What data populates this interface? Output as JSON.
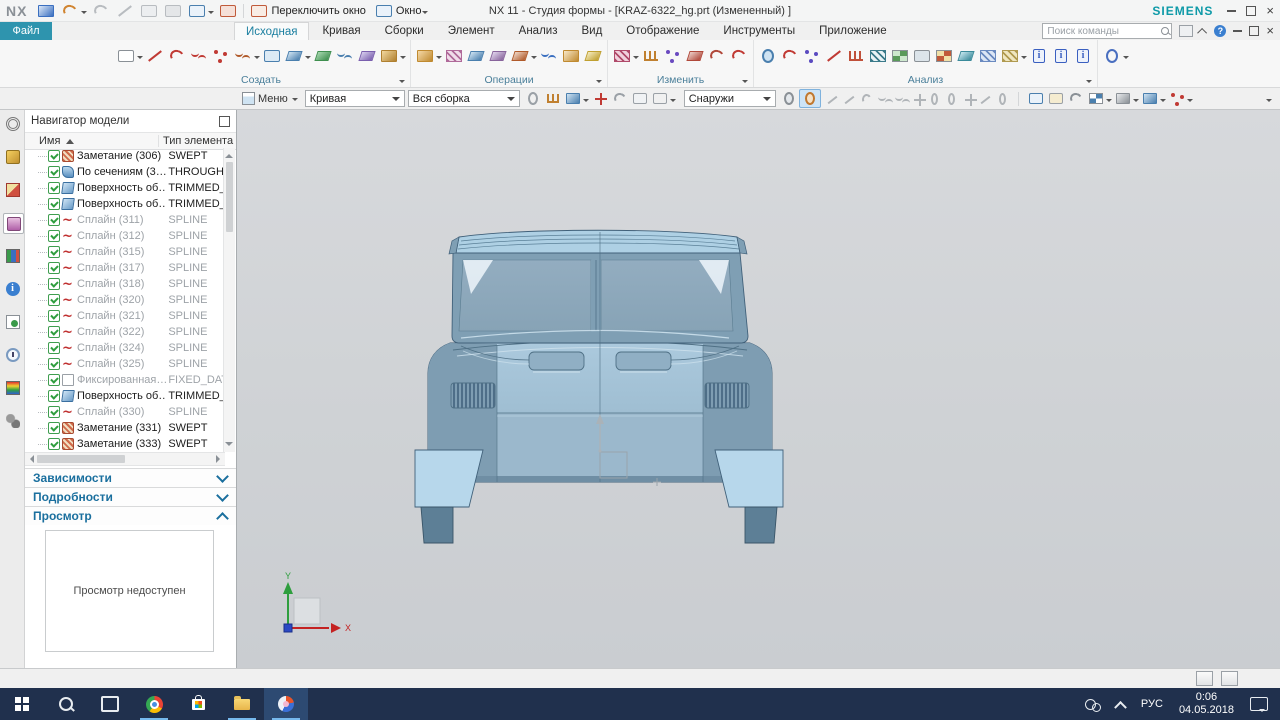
{
  "titlebar": {
    "logo": "NX",
    "title": "NX 11 - Студия формы - [KRAZ-6322_hg.prt (Измененный) ]",
    "brand": "SIEMENS",
    "switch_window": "Переключить окно",
    "window_menu": "Окно",
    "quick_icons": [
      {
        "name": "save",
        "s": "s-cube",
        "c1": "#3a6fc0",
        "c2": "#dce8f8"
      },
      {
        "name": "undo",
        "s": "s-arc",
        "c1": "#d08430",
        "dd": true
      },
      {
        "name": "redo",
        "s": "s-arc",
        "c1": "#b8bcc0"
      },
      {
        "name": "cut",
        "s": "s-line",
        "c1": "#b8bcc0"
      },
      {
        "name": "copy",
        "s": "s-rect",
        "c1": "#b8bcc0",
        "c2": "#eceef0"
      },
      {
        "name": "paste",
        "s": "s-rect",
        "c1": "#b8bcc0",
        "c2": "#e4e6e8"
      },
      {
        "name": "display-window",
        "s": "s-rect",
        "c1": "#4a7fae",
        "c2": "#eaf2fa",
        "dd": true
      },
      {
        "name": "touch-mode",
        "s": "s-rect",
        "c1": "#c05a3a",
        "c2": "#f5e0d8"
      }
    ]
  },
  "tabs": {
    "file": "Файл",
    "search_placeholder": "Поиск команды",
    "items": [
      {
        "label": "Исходная",
        "active": true
      },
      {
        "label": "Кривая"
      },
      {
        "label": "Сборки"
      },
      {
        "label": "Элемент"
      },
      {
        "label": "Анализ"
      },
      {
        "label": "Вид"
      },
      {
        "label": "Отображение"
      },
      {
        "label": "Инструменты"
      },
      {
        "label": "Приложение"
      }
    ]
  },
  "ribbon": {
    "groups": [
      {
        "label": "Создать",
        "icons": [
          {
            "name": "sketch",
            "s": "s-rect",
            "c1": "#8a9096",
            "c2": "#ffffff",
            "dd": true
          },
          {
            "name": "line",
            "s": "s-line",
            "c1": "#c03a34"
          },
          {
            "name": "arc",
            "s": "s-arc",
            "c1": "#c03a34"
          },
          {
            "name": "studio-spline",
            "s": "s-wave",
            "c1": "#c03a34"
          },
          {
            "name": "spline-points",
            "s": "s-dots",
            "c1": "#c03a34"
          },
          {
            "name": "more-curves",
            "s": "s-wave",
            "c1": "#b05a2a",
            "dd": true
          },
          {
            "name": "box",
            "s": "s-rect",
            "c1": "#4a7fae",
            "c2": "#dceaf5"
          },
          {
            "name": "datum-plane",
            "s": "s-sheet",
            "c1": "#4a7fae",
            "c2": "#cfe3f2",
            "dd": true
          },
          {
            "name": "ruled-surface",
            "s": "s-sheet",
            "c1": "#3f8f4f",
            "c2": "#a8d8b0"
          },
          {
            "name": "through-curves",
            "s": "s-wave",
            "c1": "#4a7fae"
          },
          {
            "name": "swept-surface",
            "s": "s-sheet",
            "c1": "#7a5fae",
            "c2": "#d8cfee"
          },
          {
            "name": "shell",
            "s": "s-cube",
            "c1": "#b08030",
            "c2": "#f3d9a0",
            "dd": true
          }
        ]
      },
      {
        "label": "Операции",
        "icons": [
          {
            "name": "join",
            "s": "s-cube",
            "c1": "#c08a30",
            "c2": "#f5d9a8",
            "dd": true
          },
          {
            "name": "offset-surface",
            "s": "s-stripes",
            "c1": "#b06a9a",
            "c2": "#f0dcea"
          },
          {
            "name": "trimmed-sheet",
            "s": "s-sheet",
            "c1": "#4a7fae",
            "c2": "#cfe3f2"
          },
          {
            "name": "trim-body",
            "s": "s-sheet",
            "c1": "#88649c",
            "c2": "#e2d6ee"
          },
          {
            "name": "x-trim",
            "s": "s-sheet",
            "c1": "#b05a2a",
            "c2": "#f0d8c8",
            "dd": true
          },
          {
            "name": "through-curve-mesh",
            "s": "s-wave",
            "c1": "#3a6fc0"
          },
          {
            "name": "bounded-plane",
            "s": "s-cube",
            "c1": "#c08a30",
            "c2": "#f8e8c8"
          },
          {
            "name": "patch",
            "s": "s-sheet",
            "c1": "#c0a030",
            "c2": "#f5ecc0"
          }
        ]
      },
      {
        "label": "Изменить",
        "icons": [
          {
            "name": "x-form",
            "s": "s-stripes",
            "c1": "#b04a6a",
            "c2": "#f0d0dc",
            "dd": true
          },
          {
            "name": "deform-surface",
            "s": "s-comb",
            "c1": "#c08030"
          },
          {
            "name": "edit-pole",
            "s": "s-dots",
            "c1": "#6a4ac0"
          },
          {
            "name": "smooth-surface",
            "s": "s-sheet",
            "c1": "#b0483a",
            "c2": "#eccfc8"
          },
          {
            "name": "match-edge",
            "s": "s-arc",
            "c1": "#b0483a"
          },
          {
            "name": "refit-curve",
            "s": "s-arc",
            "c1": "#c03a34"
          }
        ]
      },
      {
        "label": "Анализ",
        "icons": [
          {
            "name": "section-analysis",
            "s": "s-circle",
            "c1": "#4a7fae",
            "c2": "#cfe3f2"
          },
          {
            "name": "curvature-comb",
            "s": "s-arc",
            "c1": "#c03a34"
          },
          {
            "name": "deviation-gauge",
            "s": "s-dots",
            "c1": "#5a4ac0"
          },
          {
            "name": "measure-line",
            "s": "s-line",
            "c1": "#c03a34"
          },
          {
            "name": "hedgehog",
            "s": "s-comb",
            "c1": "#c0503a"
          },
          {
            "name": "zebra-stripes",
            "s": "s-stripes",
            "c1": "#3a7a8a",
            "c2": "#e8f2f5"
          },
          {
            "name": "reflection-map",
            "s": "s-grid",
            "c1": "#5a9a5a",
            "c2": "#cde8cd"
          },
          {
            "name": "draft-analysis",
            "s": "s-rect",
            "c1": "#8a9096",
            "c2": "#dce4ea"
          },
          {
            "name": "face-curvature",
            "s": "s-grid",
            "c1": "#c05a3a",
            "c2": "#f0e0a8"
          },
          {
            "name": "reflection-plane",
            "s": "s-sheet",
            "c1": "#3a8a9a",
            "c2": "#c8e8f0"
          },
          {
            "name": "grid-analysis",
            "s": "s-stripes",
            "c1": "#6a8ac0",
            "c2": "#dce6f5"
          },
          {
            "name": "gauge-ruler",
            "s": "s-stripes",
            "c1": "#b09a50",
            "c2": "#efe6c0",
            "dd": true
          },
          {
            "name": "info-object",
            "s": "s-tag",
            "c1": "#3a5fc0"
          },
          {
            "name": "info-spline",
            "s": "s-tag",
            "c1": "#3a5fc0"
          },
          {
            "name": "info-sheet",
            "s": "s-tag",
            "c1": "#3a5fc0"
          }
        ]
      },
      {
        "label": "",
        "icons": [
          {
            "name": "hd3d-tool",
            "s": "s-circle",
            "c1": "#4a6fc0",
            "dd": true
          }
        ]
      }
    ]
  },
  "border_bar": {
    "menu": "Меню",
    "type_combo": "Кривая",
    "scope_combo": "Вся сборка",
    "filter_combo": "Снаружи",
    "left_icons": [
      {
        "name": "touch-filter",
        "s": "s-circle",
        "c1": "#9aa0a6"
      },
      {
        "name": "selection-hand",
        "s": "s-comb",
        "c1": "#c08030"
      },
      {
        "name": "filter-cube",
        "s": "s-cube",
        "c1": "#4a7fae",
        "c2": "#cfe3f2",
        "dd": true
      },
      {
        "name": "add-to-selection",
        "s": "s-plus",
        "c1": "#c03a34"
      },
      {
        "name": "deselect-arrow",
        "s": "s-arc",
        "c1": "#9aa0a6"
      },
      {
        "name": "highlight-window",
        "s": "s-rect",
        "c1": "#9aa0a6",
        "c2": "#f0f2f4"
      },
      {
        "name": "lasso-select",
        "s": "s-rect",
        "c1": "#9aa0a6",
        "dd": true
      }
    ],
    "sphere_icons": [
      {
        "name": "rotate-point-sphere",
        "s": "s-circle",
        "c1": "#8a9096",
        "c2": "#e4e8ec"
      },
      {
        "name": "snap-point-sphere",
        "s": "s-circle",
        "c1": "#c07830",
        "c2": "#f5e2c8",
        "hl": true
      }
    ],
    "snap_icons": [
      {
        "name": "snap-endpoint",
        "s": "s-line",
        "c1": "#b0b4b8"
      },
      {
        "name": "snap-midpoint",
        "s": "s-line",
        "c1": "#b0b4b8"
      },
      {
        "name": "snap-arc",
        "s": "s-arc",
        "c1": "#b0b4b8"
      },
      {
        "name": "snap-spline",
        "s": "s-wave",
        "c1": "#b0b4b8"
      },
      {
        "name": "snap-pole",
        "s": "s-wave",
        "c1": "#b0b4b8"
      },
      {
        "name": "snap-vertex",
        "s": "s-plus",
        "c1": "#b0b4b8"
      },
      {
        "name": "snap-center",
        "s": "s-circle",
        "c1": "#b0b4b8"
      },
      {
        "name": "snap-quadrant",
        "s": "s-circle",
        "c1": "#b0b4b8"
      },
      {
        "name": "snap-intersection",
        "s": "s-plus",
        "c1": "#b0b4b8"
      },
      {
        "name": "snap-point-on-curve",
        "s": "s-line",
        "c1": "#b0b4b8"
      },
      {
        "name": "snap-bounded",
        "s": "s-circle",
        "c1": "#b0b4b8"
      }
    ],
    "view_icons": [
      {
        "name": "fit-view",
        "s": "s-rect",
        "c1": "#4a7fae",
        "c2": "#eaf2fa"
      },
      {
        "name": "zoom-window",
        "s": "s-rect",
        "c1": "#9aa0a6",
        "c2": "#f5ecd0"
      },
      {
        "name": "rotate-view",
        "s": "s-arc",
        "c1": "#8a9096"
      },
      {
        "name": "view-layout",
        "s": "s-grid",
        "c1": "#4a7fae",
        "c2": "#ffffff",
        "dd": true
      },
      {
        "name": "render-style",
        "s": "s-cube",
        "c1": "#8a9096",
        "c2": "#e8eaec",
        "dd": true
      },
      {
        "name": "shaded-view",
        "s": "s-cube",
        "c1": "#4a7fae",
        "c2": "#cfe3f2",
        "dd": true
      },
      {
        "name": "show-hide",
        "s": "s-dots",
        "c1": "#c03a34",
        "dd": true
      }
    ]
  },
  "resource_bar": {
    "items": [
      {
        "name": "settings-gear-icon",
        "cls": "r-gear"
      },
      {
        "name": "assembly-navigator-icon",
        "cls": "r-asm"
      },
      {
        "name": "constraint-navigator-icon",
        "cls": "r-con"
      },
      {
        "name": "part-navigator-icon",
        "cls": "r-part",
        "sel": true
      },
      {
        "name": "reuse-library-icon",
        "cls": "r-lib"
      },
      {
        "name": "web-browser-icon",
        "cls": "r-info"
      },
      {
        "name": "history-icon",
        "cls": "r-hist"
      },
      {
        "name": "process-studio-icon",
        "cls": "r-clock"
      },
      {
        "name": "roles-palette-icon",
        "cls": "r-roles"
      },
      {
        "name": "system-visualization-icon",
        "cls": "r-tools"
      }
    ]
  },
  "navigator": {
    "title": "Навигатор модели",
    "col_name": "Имя",
    "col_type": "Тип элемента",
    "rows": [
      {
        "name": "Заметание (306)",
        "type": "SWEPT",
        "icon": "f-swept"
      },
      {
        "name": "По сечениям (3…",
        "type": "THROUGH_C",
        "icon": "f-through"
      },
      {
        "name": "Поверхность об…",
        "type": "TRIMMED_SH",
        "icon": "f-trim"
      },
      {
        "name": "Поверхность об…",
        "type": "TRIMMED_SH",
        "icon": "f-trim"
      },
      {
        "name": "Сплайн (311)",
        "type": "SPLINE",
        "icon": "f-spline",
        "dim": true
      },
      {
        "name": "Сплайн (312)",
        "type": "SPLINE",
        "icon": "f-spline",
        "dim": true
      },
      {
        "name": "Сплайн (315)",
        "type": "SPLINE",
        "icon": "f-spline",
        "dim": true
      },
      {
        "name": "Сплайн (317)",
        "type": "SPLINE",
        "icon": "f-spline",
        "dim": true
      },
      {
        "name": "Сплайн (318)",
        "type": "SPLINE",
        "icon": "f-spline",
        "dim": true
      },
      {
        "name": "Сплайн (320)",
        "type": "SPLINE",
        "icon": "f-spline",
        "dim": true
      },
      {
        "name": "Сплайн (321)",
        "type": "SPLINE",
        "icon": "f-spline",
        "dim": true
      },
      {
        "name": "Сплайн (322)",
        "type": "SPLINE",
        "icon": "f-spline",
        "dim": true
      },
      {
        "name": "Сплайн (324)",
        "type": "SPLINE",
        "icon": "f-spline",
        "dim": true
      },
      {
        "name": "Сплайн (325)",
        "type": "SPLINE",
        "icon": "f-spline",
        "dim": true
      },
      {
        "name": "Фиксированная…",
        "type": "FIXED_DATUM",
        "icon": "f-datum",
        "dim": true
      },
      {
        "name": "Поверхность об…",
        "type": "TRIMMED_SH",
        "icon": "f-trim"
      },
      {
        "name": "Сплайн (330)",
        "type": "SPLINE",
        "icon": "f-spline",
        "dim": true
      },
      {
        "name": "Заметание (331)",
        "type": "SWEPT",
        "icon": "f-swept"
      },
      {
        "name": "Заметание (333)",
        "type": "SWEPT",
        "icon": "f-swept"
      }
    ],
    "sections": {
      "dependencies": "Зависимости",
      "details": "Подробности",
      "preview": "Просмотр"
    },
    "preview_empty": "Просмотр недоступен"
  },
  "viewport": {
    "wcs_x": "X",
    "wcs_y": "Y"
  },
  "taskbar": {
    "items": [
      {
        "name": "start-button",
        "cls": "tb-start"
      },
      {
        "name": "taskbar-search",
        "cls": "tb-search"
      },
      {
        "name": "task-view",
        "cls": "tb-task"
      },
      {
        "name": "chrome-app",
        "cls": "tb-chrome",
        "ul": true
      },
      {
        "name": "store-app",
        "cls": "tb-store"
      },
      {
        "name": "explorer-app",
        "cls": "tb-folder",
        "ul": true
      },
      {
        "name": "nx-app",
        "cls": "tb-nx",
        "ul": true,
        "active": true
      }
    ],
    "lang": "РУС",
    "time": "0:06",
    "date": "04.05.2018"
  }
}
